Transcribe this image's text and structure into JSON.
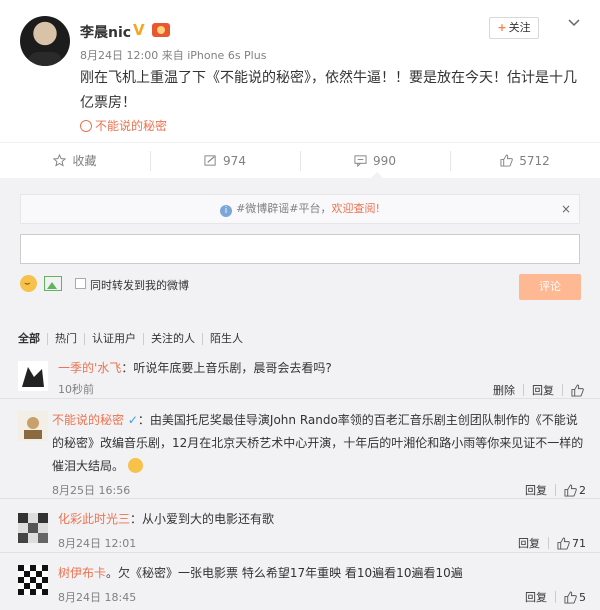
{
  "post": {
    "username": "李晨nic",
    "vip_badge": "V",
    "date": "8月24日 12:00",
    "source": "来自 iPhone 6s Plus",
    "follow_label": "关注",
    "follow_plus": "+",
    "text": "刚在飞机上重温了下《不能说的秘密》，依然牛逼！！要是放在今天！估计是十几亿票房！",
    "topic": "不能说的秘密"
  },
  "actions": {
    "favorite_label": "收藏",
    "repost_count": "974",
    "comment_count": "990",
    "like_count": "5712"
  },
  "composer": {
    "notice_text": "#微博辟谣#平台，",
    "notice_link": "欢迎查阅!",
    "notice_close": "×",
    "repost_label": "同时转发到我的微博",
    "submit_label": "评论"
  },
  "filters": [
    "全部",
    "热门",
    "认证用户",
    "关注的人",
    "陌生人"
  ],
  "comments": [
    {
      "name": "一季的'水飞",
      "text": "：听说年底要上音乐剧，晨哥会去看吗?",
      "time": "10秒前",
      "delete_label": "删除",
      "reply_label": "回复",
      "likes": ""
    },
    {
      "name": "不能说的秘密",
      "text": "：由美国托尼奖最佳导演John Rando率领的百老汇音乐剧主创团队制作的《不能说的秘密》改编音乐剧，12月在北京天桥艺术中心开演，十年后的叶湘伦和路小雨等你来见证不一样的催泪大结局。",
      "time": "8月25日 16:56",
      "reply_label": "回复",
      "likes": "2"
    },
    {
      "name": "化彩此时光三",
      "text": "：从小爱到大的电影还有歌",
      "time": "8月24日 12:01",
      "reply_label": "回复",
      "likes": "71"
    },
    {
      "name": "树伊布卡",
      "text": "。欠《秘密》一张电影票 特么希望17年重映 看10遍看10遍看10遍",
      "time": "8月24日 18:45",
      "reply_label": "回复",
      "likes": "5"
    }
  ]
}
